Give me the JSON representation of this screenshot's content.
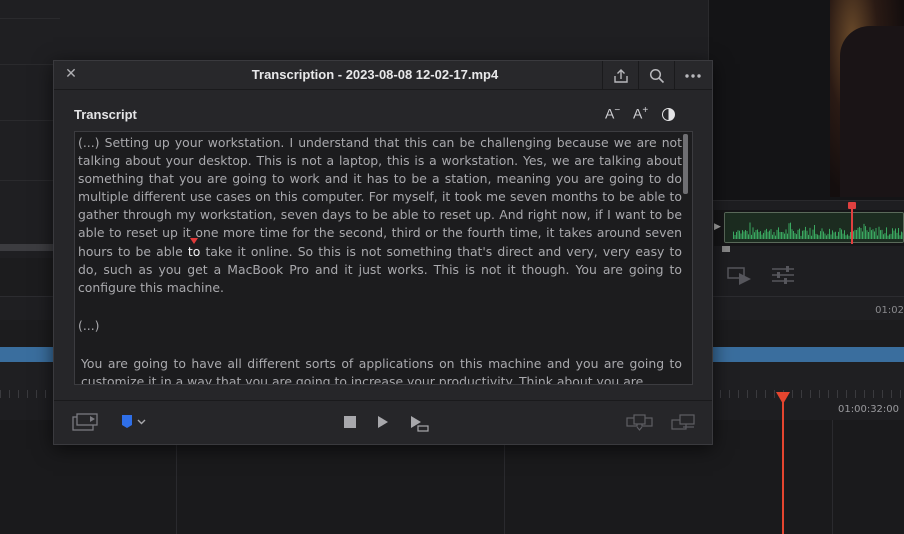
{
  "window": {
    "title": "Transcription - 2023-08-08 12-02-17.mp4",
    "close_icon": "close-icon",
    "export_icon": "export-icon",
    "search_icon": "search-icon",
    "more_icon": "more-options-icon"
  },
  "transcript": {
    "label": "Transcript",
    "decrease_font": "A",
    "decrease_sign": "−",
    "increase_font": "A",
    "increase_sign": "+",
    "p1_pre": "(...) Setting up your workstation. I understand that this can be challenging because we are not talking about your desktop. This is not a laptop, this is a workstation. Yes, we are talking about something that you are going to work and it has to be a station, meaning you are going to do multiple different use cases on this computer. For myself, it took me seven months to be able to gather through my workstation, seven days to be able to reset up. And right now, if I want to be able to reset up it one more time for the second, third or the fourth time, it takes around seven hours to be able",
    "p1_highlight": "to",
    "p1_post": "take it online. So this is not something that's direct and very, very easy to do, such as you get a MacBook Pro and it just works. This is not it though. You are going to configure this machine.",
    "p2": "(...)",
    "p3": "You are going to have all different sorts of applications on this machine and you are going to customize it in a way that you are going to increase your productivity. Think about you are"
  },
  "timeline": {
    "timecode_top": "01:02",
    "timecode_ruler": "01:00:32:00"
  },
  "colors": {
    "accent_blue": "#3a6e9e",
    "playhead_red": "#e4452f",
    "flag_blue": "#2f6fe8"
  }
}
